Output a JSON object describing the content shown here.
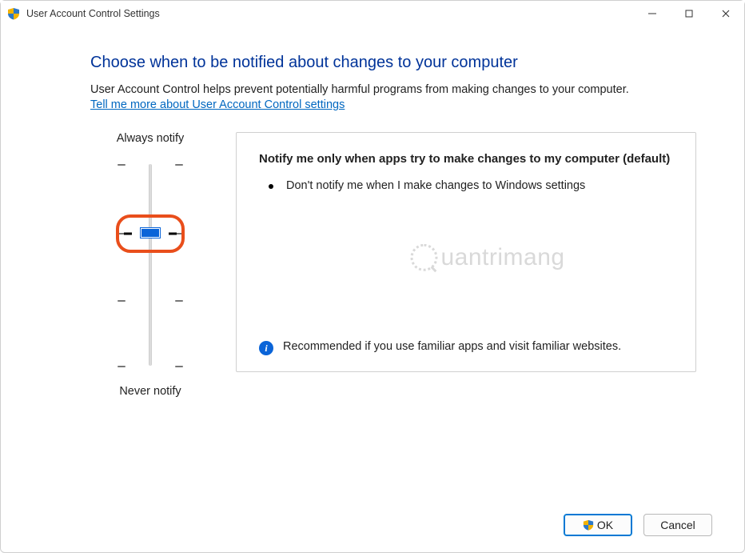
{
  "window": {
    "title": "User Account Control Settings"
  },
  "main": {
    "heading": "Choose when to be notified about changes to your computer",
    "description": "User Account Control helps prevent potentially harmful programs from making changes to your computer.",
    "help_link": "Tell me more about User Account Control settings"
  },
  "slider": {
    "top_label": "Always notify",
    "bottom_label": "Never notify",
    "levels": 4,
    "selected_index": 1
  },
  "panel": {
    "title": "Notify me only when apps try to make changes to my computer (default)",
    "bullet_1": "Don't notify me when I make changes to Windows settings",
    "recommendation": "Recommended if you use familiar apps and visit familiar websites."
  },
  "buttons": {
    "ok": "OK",
    "cancel": "Cancel"
  },
  "watermark": {
    "text": "uantrimang"
  },
  "colors": {
    "accent": "#0a64d8",
    "link": "#0067c0",
    "heading": "#003399",
    "highlight_ring": "#e94e1b"
  }
}
